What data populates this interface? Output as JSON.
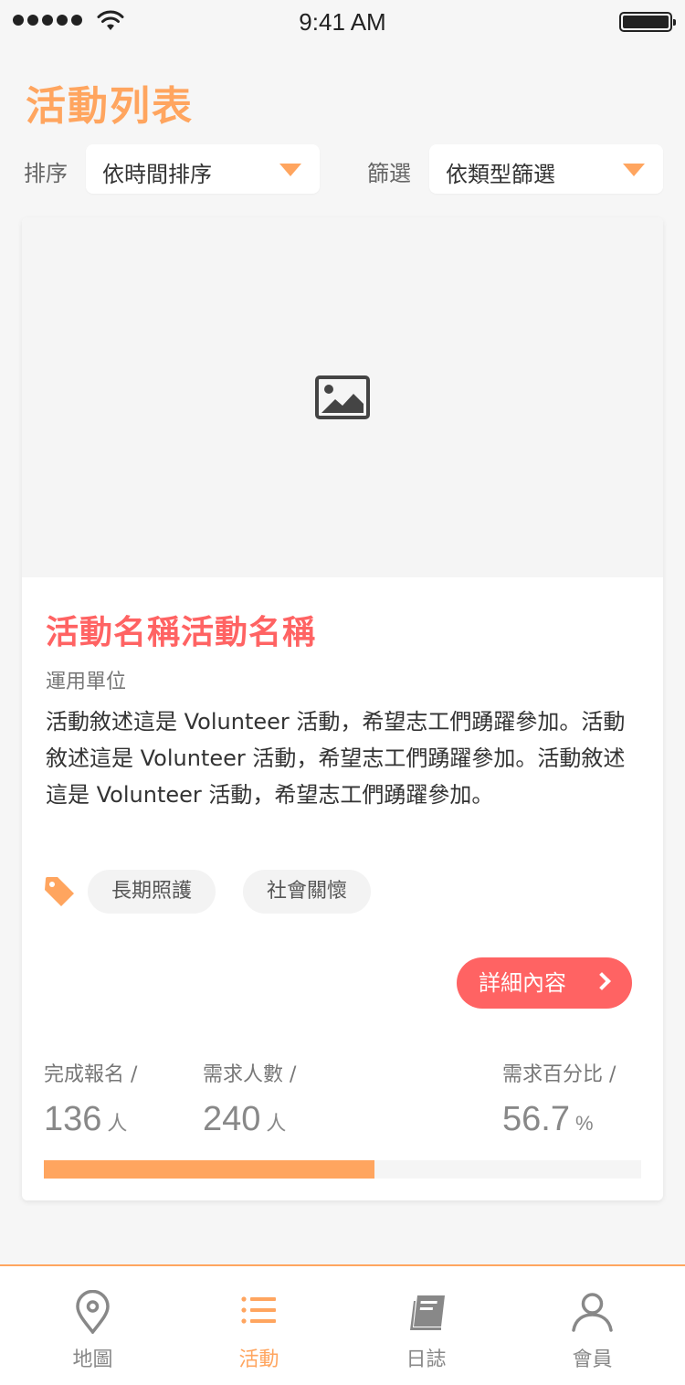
{
  "status_bar": {
    "time": "9:41 AM"
  },
  "header": {
    "title": "活動列表"
  },
  "filters": {
    "sort_label": "排序",
    "sort_value": "依時間排序",
    "filter_label": "篩選",
    "filter_value": "依類型篩選"
  },
  "card": {
    "title": "活動名稱活動名稱",
    "organization": "運用單位",
    "description": "活動敘述這是 Volunteer 活動，希望志工們踴躍參加。活動敘述這是 Volunteer 活動，希望志工們踴躍參加。活動敘述這是 Volunteer 活動，希望志工們踴躍參加。",
    "tags": [
      "長期照護",
      "社會關懷"
    ],
    "detail_button": "詳細內容",
    "stats": {
      "registered_label": "完成報名 /",
      "registered_value": "136",
      "registered_unit": "人",
      "needed_label": "需求人數 /",
      "needed_value": "240",
      "needed_unit": "人",
      "percent_label": "需求百分比 /",
      "percent_value": "56.7",
      "percent_unit": "%"
    },
    "progress_fraction": 0.553
  },
  "tabs": [
    {
      "label": "地圖",
      "icon": "map-pin-icon",
      "active": false
    },
    {
      "label": "活動",
      "icon": "list-icon",
      "active": true
    },
    {
      "label": "日誌",
      "icon": "book-icon",
      "active": false
    },
    {
      "label": "會員",
      "icon": "user-icon",
      "active": false
    }
  ],
  "colors": {
    "accent": "#ffa55f",
    "primary_red": "#ff6363",
    "inactive_tab": "#888888"
  }
}
